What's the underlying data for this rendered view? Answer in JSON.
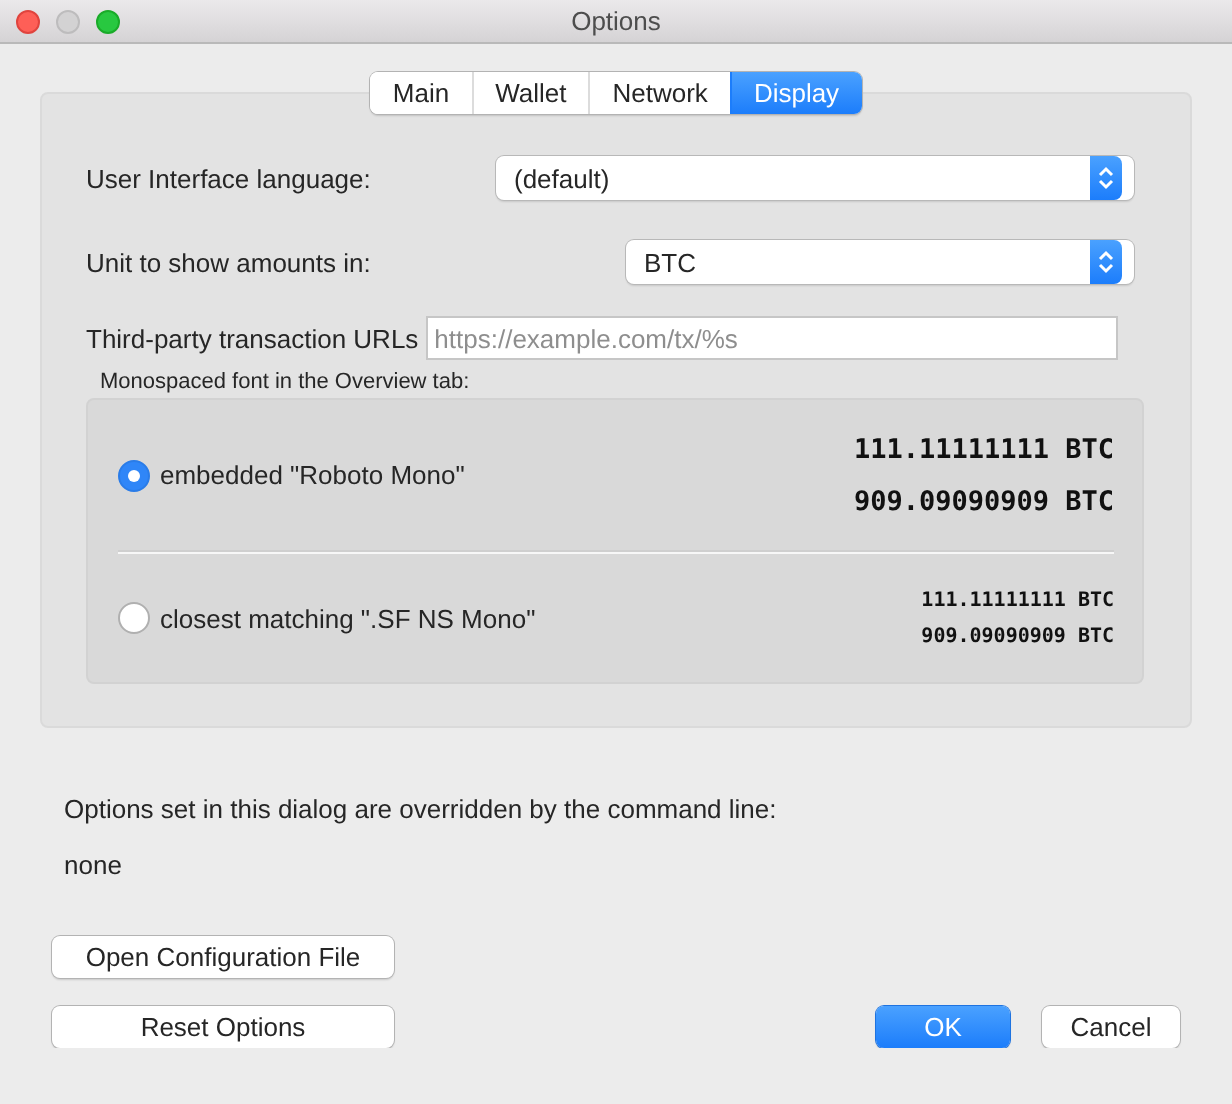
{
  "window": {
    "title": "Options"
  },
  "tabs": [
    {
      "label": "Main",
      "selected": false
    },
    {
      "label": "Wallet",
      "selected": false
    },
    {
      "label": "Network",
      "selected": false
    },
    {
      "label": "Display",
      "selected": true
    }
  ],
  "fields": [
    {
      "kind": "select",
      "label": "User Interface language:",
      "value": "(default)"
    },
    {
      "kind": "select",
      "label": "Unit to show amounts in:",
      "value": "BTC"
    },
    {
      "kind": "text",
      "label": "Third-party transaction URLs",
      "placeholder": "https://example.com/tx/%s"
    }
  ],
  "font_group": {
    "title": "Monospaced font in the Overview tab:",
    "options": [
      {
        "label": "embedded \"Roboto Mono\"",
        "selected": true,
        "samples": [
          "111.11111111 BTC",
          "909.09090909 BTC"
        ]
      },
      {
        "label": "closest matching \".SF NS Mono\"",
        "selected": false,
        "samples": [
          "111.11111111 BTC",
          "909.09090909 BTC"
        ]
      }
    ]
  },
  "overrides": {
    "label": "Options set in this dialog are overridden by the command line:",
    "value": "none"
  },
  "buttons": [
    {
      "kind": "plain",
      "label": "Open Configuration File"
    },
    {
      "kind": "plain",
      "label": "Reset Options"
    },
    {
      "kind": "default",
      "label": "OK"
    },
    {
      "kind": "plain",
      "label": "Cancel"
    }
  ]
}
